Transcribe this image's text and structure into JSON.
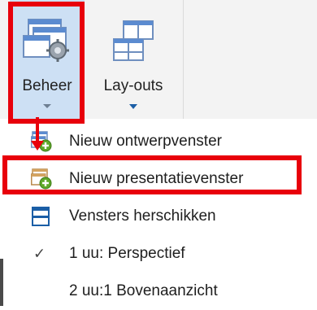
{
  "ribbon": {
    "beheer": {
      "label": "Beheer",
      "icon": "window-gear-icon"
    },
    "layouts": {
      "label": "Lay-outs",
      "icon": "window-layout-icon"
    }
  },
  "menu": {
    "items": [
      {
        "label": "Nieuw ontwerpvenster",
        "icon": "new-window-plus-icon"
      },
      {
        "label": "Nieuw presentatievenster",
        "icon": "new-presentation-window-plus-icon"
      },
      {
        "label": "Vensters herschikken",
        "icon": "rearrange-windows-icon"
      },
      {
        "label": "1 uu: Perspectief",
        "checked": true,
        "check_glyph": "✓"
      },
      {
        "label": "2 uu:1 Bovenaanzicht",
        "checked": false
      }
    ]
  },
  "colors": {
    "highlight": "#e8000b",
    "selected_button": "#cde0f4",
    "ribbon_bg": "#f3f3f3",
    "accent_blue": "#1b5ea6",
    "plus_green": "#5fa82a"
  }
}
